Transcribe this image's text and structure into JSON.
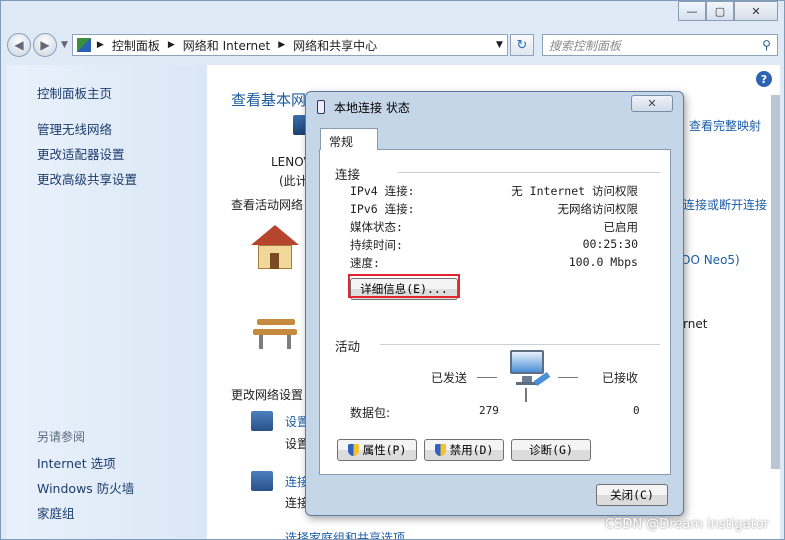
{
  "window": {
    "minimize": "—",
    "maximize": "▢",
    "close": "✕"
  },
  "nav": {
    "back": "◀",
    "forward": "▶",
    "dropdown": "▼",
    "breadcrumb": [
      "控制面板",
      "网络和 Internet",
      "网络和共享中心"
    ],
    "refresh": "↻",
    "search_placeholder": "搜索控制面板"
  },
  "sidebar": {
    "home": "控制面板主页",
    "links": [
      "管理无线网络",
      "更改适配器设置",
      "更改高级共享设置"
    ],
    "see_also_header": "另请参阅",
    "see_also": [
      "Internet 选项",
      "Windows 防火墙",
      "家庭组"
    ]
  },
  "main": {
    "title": "查看基本网络信息并设置连接",
    "full_map": "查看完整映射",
    "computer_name": "LENOV",
    "computer_sub": "(此计",
    "active_networks": "查看活动网络",
    "connect_disconnect": "连接或断开连接",
    "network_name": "OO Neo5)",
    "access_type": "rnet",
    "change_settings": "更改网络设置",
    "task1_link": "设置",
    "task1_desc": "设置",
    "task2_link": "连接",
    "task2_desc": "连接",
    "task3_link": "选择家庭组和共享选项"
  },
  "dialog": {
    "title": "本地连接 状态",
    "close_label": "✕",
    "tab": "常规",
    "connection_header": "连接",
    "rows": [
      {
        "label": "IPv4 连接:",
        "value": "无 Internet 访问权限"
      },
      {
        "label": "IPv6 连接:",
        "value": "无网络访问权限"
      },
      {
        "label": "媒体状态:",
        "value": "已启用"
      },
      {
        "label": "持续时间:",
        "value": "00:25:30"
      },
      {
        "label": "速度:",
        "value": "100.0 Mbps"
      }
    ],
    "details_button": "详细信息(E)...",
    "activity_header": "活动",
    "sent_label": "已发送",
    "received_label": "已接收",
    "packets_label": "数据包:",
    "packets_sent": "279",
    "packets_received": "0",
    "properties_button": "属性(P)",
    "disable_button": "禁用(D)",
    "diagnose_button": "诊断(G)",
    "close_button": "关闭(C)"
  },
  "watermark": "CSDN @Dream instigator"
}
